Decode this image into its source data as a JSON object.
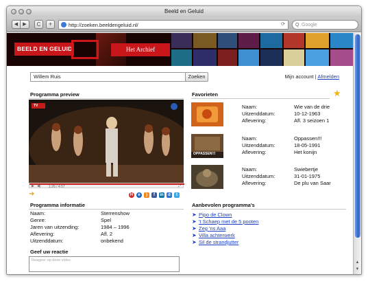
{
  "window": {
    "title": "Beeld en Geluid"
  },
  "toolbar": {
    "back": "◀",
    "forward": "▶",
    "reload": "C",
    "add": "+",
    "url": "http://zoeken.beeldengeluid.nl/",
    "search_placeholder": "Google",
    "search_engine_glyph": "Q"
  },
  "banner": {
    "logo_text": "BEELD EN GELUID",
    "archief_text": "Het Archief"
  },
  "search": {
    "value": "Willem Ruis",
    "button": "Zoeken"
  },
  "account": {
    "mijn_account": "Mijn account",
    "separator": "|",
    "afmelden": "Afmelden"
  },
  "preview": {
    "title": "Programma preview"
  },
  "info": {
    "title": "Programma informatie",
    "rows": [
      {
        "k": "Naam:",
        "v": "Sterrenshow"
      },
      {
        "k": "Genre:",
        "v": "Spel"
      },
      {
        "k": "Jaren van uitzending:",
        "v": "1984 – 1996"
      },
      {
        "k": "Aflevering:",
        "v": "Afl. 2"
      },
      {
        "k": "Uitzenddatum:",
        "v": "onbekend"
      }
    ]
  },
  "reactie": {
    "title": "Geef uw reactie",
    "placeholder": "Reageer op deze video"
  },
  "favorieten": {
    "title": "Favorieten",
    "items": [
      {
        "naam_k": "Naam:",
        "naam": "Wie van de drie",
        "datum_k": "Uitzenddatum:",
        "datum": "10-12-1963",
        "afl_k": "Aflevering:",
        "afl": "Afl. 3 seizoen 1"
      },
      {
        "naam_k": "Naam:",
        "naam": "Oppassen!!!",
        "datum_k": "Uitzenddatum:",
        "datum": "18-05-1991",
        "afl_k": "Aflevering:",
        "afl": "Het konijn"
      },
      {
        "naam_k": "Naam:",
        "naam": "Swiebertje",
        "datum_k": "Uitzenddatum:",
        "datum": "31-01-1975",
        "afl_k": "Aflevering:",
        "afl": "De plu van Saar"
      }
    ],
    "thumb2_caption": "OPPASSEN!!!"
  },
  "aanbevolen": {
    "title": "Aanbevolen programma's",
    "items": [
      "Pipo de Clown",
      "'t Schaep met de 5 pooten",
      "Zeg 'ns Aaa",
      "Villa achterwerk",
      "Sil de strandjutter"
    ]
  },
  "video": {
    "channel_badge": "TV",
    "time": "1:26 / 4:57"
  },
  "colors": {
    "brand_red": "#c8161b",
    "link_blue": "#1a3fc4",
    "star": "#f2b40c"
  }
}
